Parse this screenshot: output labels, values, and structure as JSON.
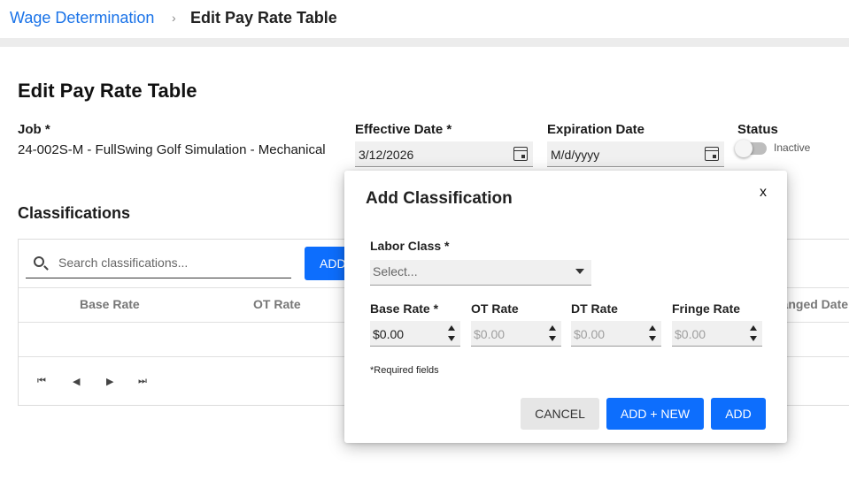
{
  "breadcrumb": {
    "parent": "Wage Determination",
    "separator": "›",
    "current": "Edit Pay Rate Table"
  },
  "page": {
    "title": "Edit Pay Rate Table"
  },
  "form": {
    "job_label": "Job *",
    "job_value": "24-002S-M - FullSwing Golf Simulation - Mechanical",
    "effective_label": "Effective Date *",
    "effective_value": "3/12/2026",
    "expiration_label": "Expiration Date",
    "expiration_placeholder": "M/d/yyyy",
    "status_label": "Status",
    "status_value": "Inactive"
  },
  "classifications": {
    "title": "Classifications",
    "search_placeholder": "Search classifications...",
    "add_label": "ADD",
    "columns": [
      "Base Rate",
      "OT Rate",
      "hanged Date"
    ]
  },
  "dialog": {
    "title": "Add Classification",
    "close": "x",
    "labor_label": "Labor Class *",
    "labor_placeholder": "Select...",
    "base_label": "Base Rate *",
    "base_value": "$0.00",
    "ot_label": "OT Rate",
    "ot_value": "$0.00",
    "dt_label": "DT Rate",
    "dt_value": "$0.00",
    "fringe_label": "Fringe Rate",
    "fringe_value": "$0.00",
    "required_note": "*Required fields",
    "cancel": "CANCEL",
    "add_new": "ADD + NEW",
    "add": "ADD"
  },
  "pager": {
    "first": "⏮",
    "prev": "◀",
    "next": "▶",
    "last": "⏭"
  },
  "colors": {
    "accent": "#0d6efd",
    "link": "#1a73e8"
  }
}
